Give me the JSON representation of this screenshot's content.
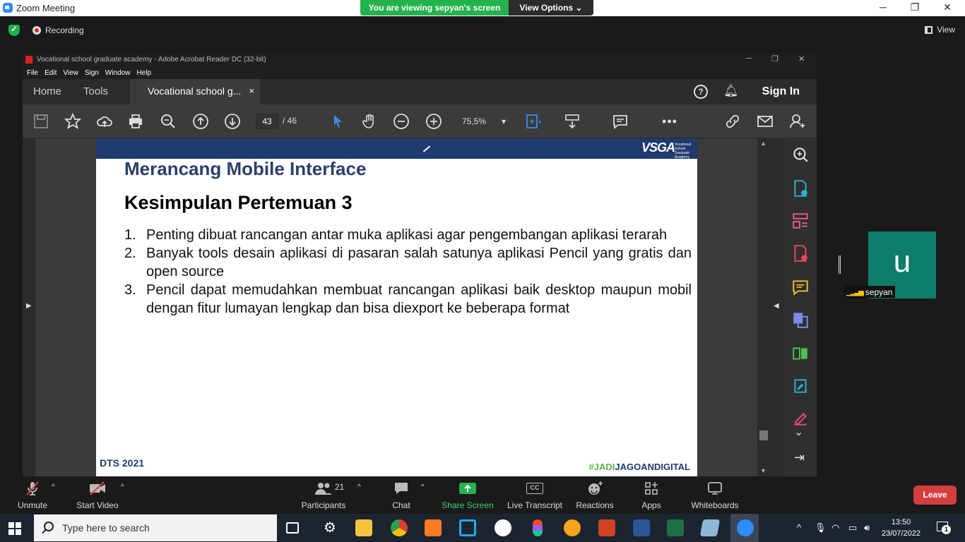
{
  "zoom": {
    "window_title": "Zoom Meeting",
    "banner_viewing": "You are viewing sepyan's screen",
    "banner_options": "View Options",
    "recording": "Recording",
    "view": "View"
  },
  "acrobat": {
    "window_title": "Vocational school graduate academy - Adobe Acrobat Reader DC (32-bit)",
    "menu": [
      "File",
      "Edit",
      "View",
      "Sign",
      "Window",
      "Help"
    ],
    "tab_home": "Home",
    "tab_tools": "Tools",
    "doc_tab": "Vocational school g...",
    "doc_tab_close": "×",
    "sign_in": "Sign In",
    "page_current": "43",
    "page_total": "/  46",
    "zoom_level": "75,5%"
  },
  "slide": {
    "logo": "VSGA",
    "logo_sub": "Vocational School Graduate Academy",
    "subtitle": "Merancang Mobile Interface",
    "title": "Kesimpulan Pertemuan 3",
    "points": [
      {
        "num": "1.",
        "text": "Penting dibuat rancangan antar muka aplikasi agar pengembangan aplikasi terarah"
      },
      {
        "num": "2.",
        "text": "Banyak tools desain aplikasi di pasaran salah satunya aplikasi Pencil yang gratis dan open source"
      },
      {
        "num": "3.",
        "text": "Pencil dapat memudahkan membuat rancangan aplikasi baik desktop maupun mobil dengan fitur lumayan lengkap dan bisa diexport ke beberapa format"
      }
    ],
    "footer_left": "DTS 2021",
    "footer_right_a": "#JADI",
    "footer_right_b": "JAGOANDIGITAL"
  },
  "participant": {
    "initial": "u",
    "name": "sepyan"
  },
  "controls": {
    "unmute": "Unmute",
    "start_video": "Start Video",
    "participants": "Participants",
    "participants_count": "21",
    "chat": "Chat",
    "share_screen": "Share Screen",
    "live_transcript": "Live Transcript",
    "reactions": "Reactions",
    "apps": "Apps",
    "whiteboards": "Whiteboards",
    "leave": "Leave",
    "cc": "CC"
  },
  "taskbar": {
    "search_placeholder": "Type here to search",
    "time": "13:50",
    "date": "23/07/2022",
    "notifications": "1"
  },
  "colors": {
    "zoom_green": "#24b24d",
    "leave_red": "#d43e3e",
    "slide_navy": "#1e3a6e",
    "tile_teal": "#0d7c6a"
  }
}
